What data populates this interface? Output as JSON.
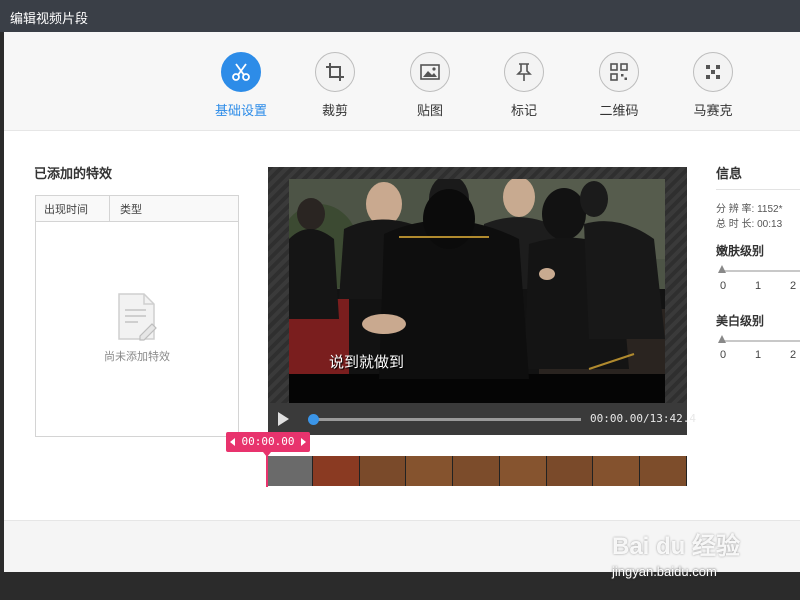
{
  "window": {
    "title": "编辑视频片段"
  },
  "toolbar": {
    "tools": [
      {
        "label": "基础设置",
        "icon": "scissors-icon",
        "active": true
      },
      {
        "label": "裁剪",
        "icon": "crop-icon",
        "active": false
      },
      {
        "label": "贴图",
        "icon": "image-icon",
        "active": false
      },
      {
        "label": "标记",
        "icon": "pin-icon",
        "active": false
      },
      {
        "label": "二维码",
        "icon": "qrcode-icon",
        "active": false
      },
      {
        "label": "马赛克",
        "icon": "mosaic-icon",
        "active": false
      }
    ]
  },
  "effects": {
    "title": "已添加的特效",
    "columns": [
      "出现时间",
      "类型"
    ],
    "empty_text": "尚未添加特效"
  },
  "player": {
    "subtitle": "说到就做到",
    "time_text": "00:00.00/13:42.4",
    "progress": 0.0
  },
  "timeline": {
    "marker_time": "00:00.00",
    "accent_color": "#e8336d"
  },
  "info": {
    "title": "信息",
    "resolution_text": "分 辨 率: 1152*",
    "duration_text": "总 时 长: 00:13",
    "skin_title": "嫩肤级别",
    "skin_ticks": [
      "0",
      "1",
      "2"
    ],
    "whiten_title": "美白级别",
    "whiten_ticks": [
      "0",
      "1",
      "2"
    ]
  },
  "watermark": {
    "brand": "Bai du 经验",
    "url": "jingyan.baidu.com"
  },
  "colors": {
    "accent_blue": "#2d8ce8",
    "titlebar": "#3a3f47"
  }
}
